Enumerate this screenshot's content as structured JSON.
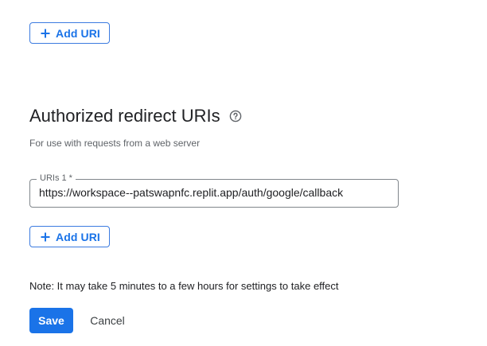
{
  "top_add_button": {
    "label": "Add URI",
    "icon": "plus-icon"
  },
  "redirect_section": {
    "title": "Authorized redirect URIs",
    "help_icon": "help-circle-icon",
    "subtitle": "For use with requests from a web server",
    "uri_field": {
      "label": "URIs 1 *",
      "value": "https://workspace--patswapnfc.replit.app/auth/google/callback"
    },
    "add_button": {
      "label": "Add URI",
      "icon": "plus-icon"
    }
  },
  "note": "Note: It may take 5 minutes to a few hours for settings to take effect",
  "actions": {
    "save_label": "Save",
    "cancel_label": "Cancel"
  },
  "colors": {
    "accent": "#1a73e8",
    "text": "#202124",
    "secondary_text": "#5f6368"
  }
}
